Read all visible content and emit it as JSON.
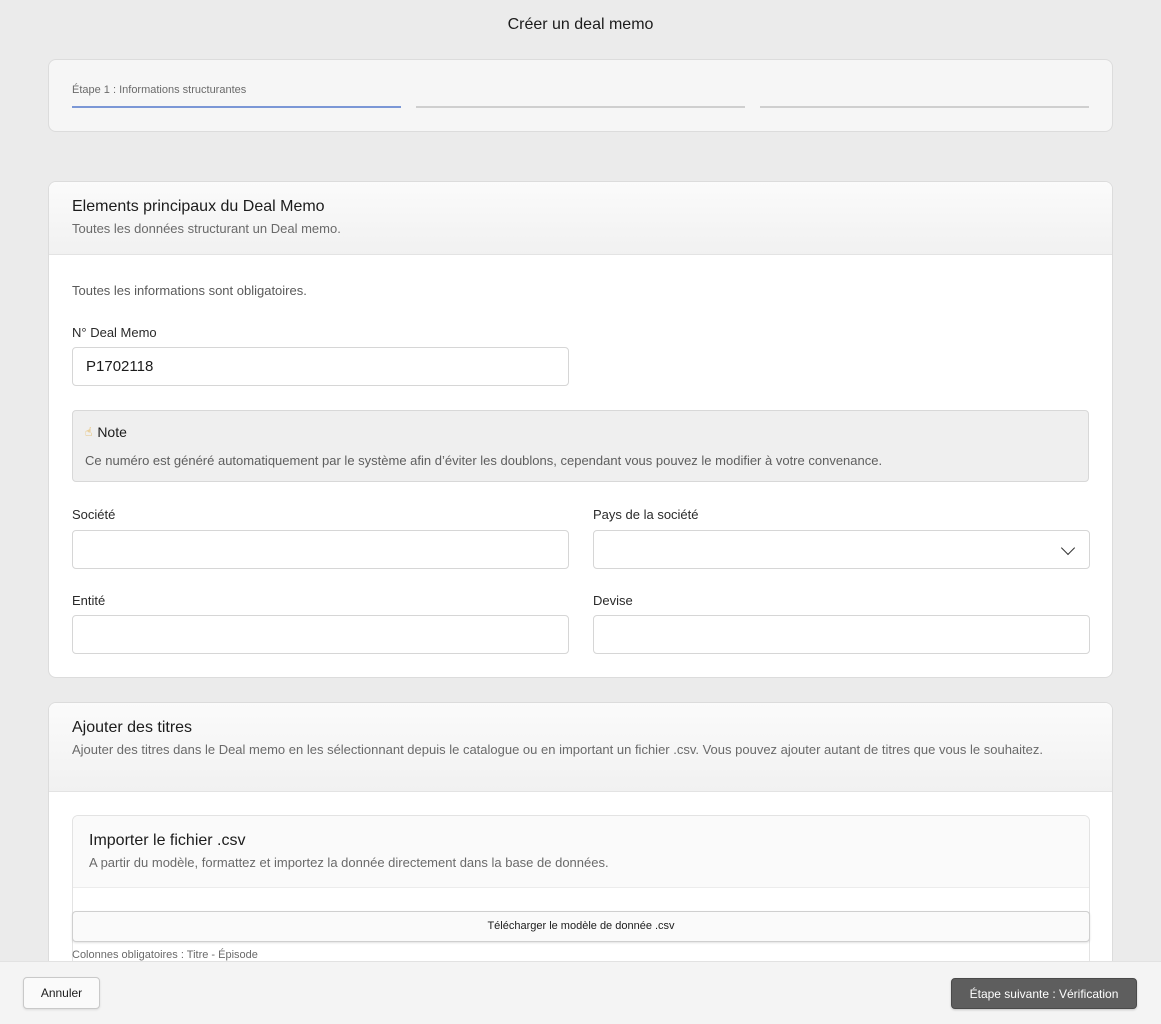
{
  "page": {
    "title": "Créer un deal memo"
  },
  "stepper": {
    "steps": [
      {
        "label": "Étape 1 : Informations structurantes",
        "active": true
      },
      {
        "label": "",
        "active": false
      },
      {
        "label": "",
        "active": false
      }
    ]
  },
  "main_section": {
    "title": "Elements principaux du Deal Memo",
    "subtitle": "Toutes les données structurant un Deal memo.",
    "required_notice": "Toutes les informations sont obligatoires.",
    "deal_memo_number": {
      "label": "N° Deal Memo",
      "value": "P1702118"
    },
    "note": {
      "icon": "pointing-finger-icon",
      "title": "Note",
      "text": "Ce numéro est généré automatiquement par le système afin d’éviter les doublons, cependant vous pouvez le modifier à votre convenance."
    },
    "company": {
      "label": "Société",
      "value": ""
    },
    "company_country": {
      "label": "Pays de la société",
      "value": ""
    },
    "entity": {
      "label": "Entité",
      "value": ""
    },
    "currency": {
      "label": "Devise",
      "value": ""
    }
  },
  "titles_section": {
    "title": "Ajouter des titres",
    "subtitle": "Ajouter des titres dans le Deal memo en les sélectionnant depuis le catalogue ou en important un fichier .csv.  Vous pouvez ajouter autant de titres que vous le souhaitez.",
    "import": {
      "title": "Importer le fichier .csv",
      "subtitle": "A partir du modèle, formattez et importez la donnée directement dans la base de données.",
      "download_label": "Télécharger le modèle de donnée .csv",
      "required_columns": "Colonnes obligatoires : Titre - Épisode"
    }
  },
  "footer": {
    "cancel_label": "Annuler",
    "next_label": "Étape suivante : Vérification"
  }
}
